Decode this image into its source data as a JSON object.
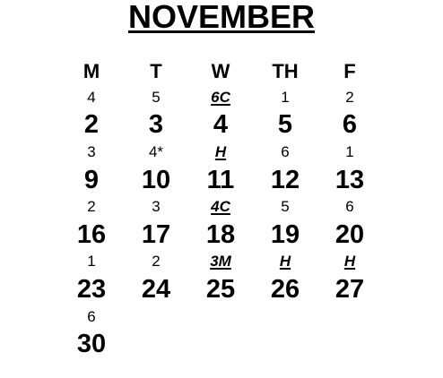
{
  "calendar": {
    "month": "NOVEMBER",
    "days_of_week": [
      "M",
      "T",
      "W",
      "TH",
      "F"
    ],
    "weeks": [
      {
        "codes": [
          {
            "text": "4",
            "special": false
          },
          {
            "text": "5",
            "special": false
          },
          {
            "text": "6C",
            "special": true
          },
          {
            "text": "1",
            "special": false
          },
          {
            "text": "2",
            "special": false
          }
        ],
        "dates": [
          "2",
          "3",
          "4",
          "5",
          "6"
        ]
      },
      {
        "codes": [
          {
            "text": "3",
            "special": false
          },
          {
            "text": "4*",
            "special": false
          },
          {
            "text": "H",
            "special": true
          },
          {
            "text": "6",
            "special": false
          },
          {
            "text": "1",
            "special": false
          }
        ],
        "dates": [
          "9",
          "10",
          "11",
          "12",
          "13"
        ]
      },
      {
        "codes": [
          {
            "text": "2",
            "special": false
          },
          {
            "text": "3",
            "special": false
          },
          {
            "text": "4C",
            "special": true
          },
          {
            "text": "5",
            "special": false
          },
          {
            "text": "6",
            "special": false
          }
        ],
        "dates": [
          "16",
          "17",
          "18",
          "19",
          "20"
        ]
      },
      {
        "codes": [
          {
            "text": "1",
            "special": false
          },
          {
            "text": "2",
            "special": false
          },
          {
            "text": "3M",
            "special": true
          },
          {
            "text": "H",
            "special": true
          },
          {
            "text": "H",
            "special": true
          }
        ],
        "dates": [
          "23",
          "24",
          "25",
          "26",
          "27"
        ]
      },
      {
        "codes": [
          {
            "text": "6",
            "special": false
          }
        ],
        "dates": [
          "30"
        ]
      }
    ]
  }
}
